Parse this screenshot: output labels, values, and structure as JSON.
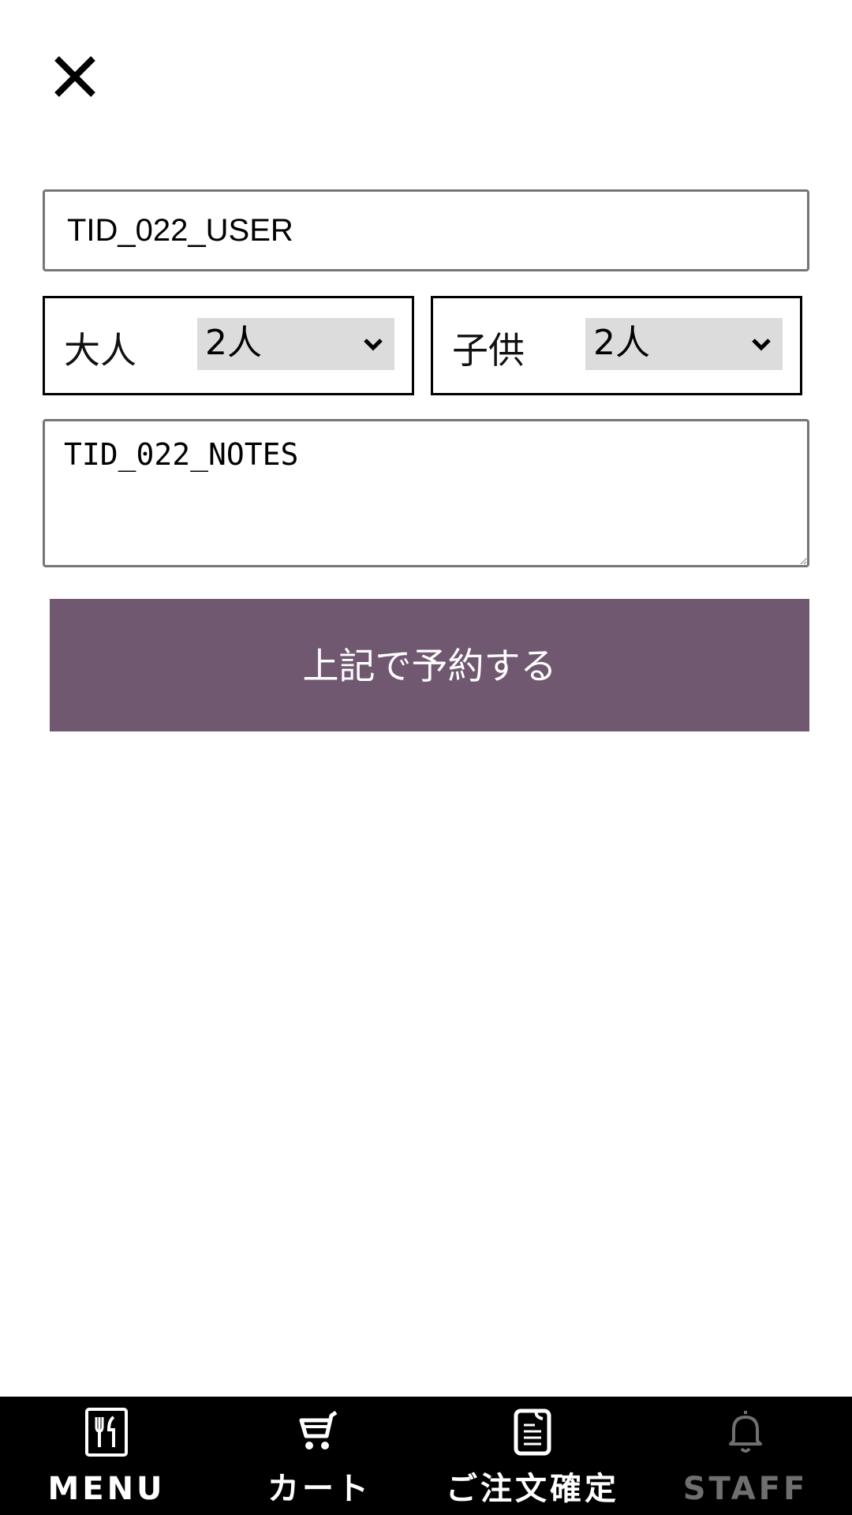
{
  "header": {
    "close_icon": "close-icon"
  },
  "form": {
    "name_value": "TID_022_USER",
    "adult": {
      "label": "大人",
      "selected": "2人"
    },
    "child": {
      "label": "子供",
      "selected": "2人"
    },
    "notes_value": "TID_022_NOTES",
    "submit_label": "上記で予約する",
    "accent_color": "#705871"
  },
  "bottom_nav": {
    "items": [
      {
        "label": "MENU",
        "icon": "menu-utensils-icon",
        "enabled": true
      },
      {
        "label": "カート",
        "icon": "cart-icon",
        "enabled": true
      },
      {
        "label": "ご注文確定",
        "icon": "order-document-icon",
        "enabled": true
      },
      {
        "label": "STAFF",
        "icon": "bell-icon",
        "enabled": false
      }
    ]
  }
}
